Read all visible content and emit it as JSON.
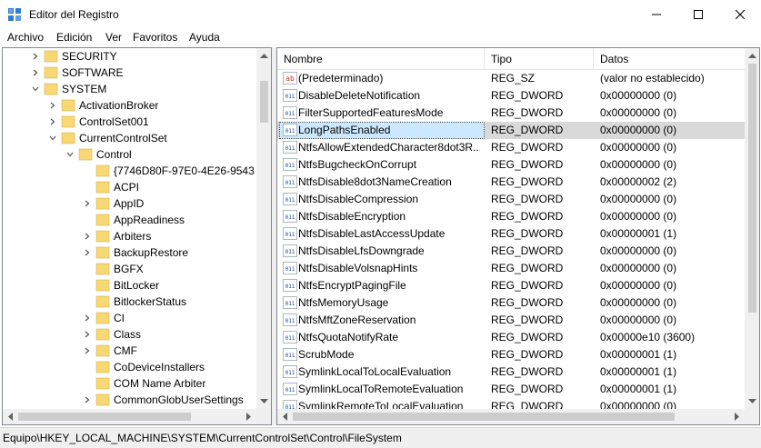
{
  "window": {
    "title": "Editor del Registro",
    "icon": "registry-editor-icon"
  },
  "menu": [
    {
      "label": "Archivo"
    },
    {
      "label": "Edición"
    },
    {
      "label": "Ver"
    },
    {
      "label": "Favoritos"
    },
    {
      "label": "Ayuda"
    }
  ],
  "tree": [
    {
      "label": "SECURITY",
      "expander": "right",
      "depth": 0
    },
    {
      "label": "SOFTWARE",
      "expander": "right",
      "depth": 0
    },
    {
      "label": "SYSTEM",
      "expander": "down",
      "depth": 0
    },
    {
      "label": "ActivationBroker",
      "expander": "right",
      "depth": 1
    },
    {
      "label": "ControlSet001",
      "expander": "right",
      "depth": 1
    },
    {
      "label": "CurrentControlSet",
      "expander": "down",
      "depth": 1
    },
    {
      "label": "Control",
      "expander": "down",
      "depth": 2
    },
    {
      "label": "{7746D80F-97E0-4E26-9543",
      "expander": "none",
      "depth": 3
    },
    {
      "label": "ACPI",
      "expander": "none",
      "depth": 3
    },
    {
      "label": "AppID",
      "expander": "right",
      "depth": 3
    },
    {
      "label": "AppReadiness",
      "expander": "none",
      "depth": 3
    },
    {
      "label": "Arbiters",
      "expander": "right",
      "depth": 3
    },
    {
      "label": "BackupRestore",
      "expander": "right",
      "depth": 3
    },
    {
      "label": "BGFX",
      "expander": "none",
      "depth": 3
    },
    {
      "label": "BitLocker",
      "expander": "none",
      "depth": 3
    },
    {
      "label": "BitlockerStatus",
      "expander": "none",
      "depth": 3
    },
    {
      "label": "CI",
      "expander": "right",
      "depth": 3
    },
    {
      "label": "Class",
      "expander": "right",
      "depth": 3
    },
    {
      "label": "CMF",
      "expander": "right",
      "depth": 3
    },
    {
      "label": "CoDeviceInstallers",
      "expander": "none",
      "depth": 3
    },
    {
      "label": "COM Name Arbiter",
      "expander": "none",
      "depth": 3
    },
    {
      "label": "CommonGlobUserSettings",
      "expander": "right",
      "depth": 3
    }
  ],
  "list": {
    "columns": [
      "Nombre",
      "Tipo",
      "Datos"
    ],
    "rows": [
      {
        "name": "(Predeterminado)",
        "type": "REG_SZ",
        "data": "(valor no establecido)",
        "icon": "string-value-icon"
      },
      {
        "name": "DisableDeleteNotification",
        "type": "REG_DWORD",
        "data": "0x00000000 (0)",
        "icon": "binary-value-icon"
      },
      {
        "name": "FilterSupportedFeaturesMode",
        "type": "REG_DWORD",
        "data": "0x00000000 (0)",
        "icon": "binary-value-icon"
      },
      {
        "name": "LongPathsEnabled",
        "type": "REG_DWORD",
        "data": "0x00000000 (0)",
        "icon": "binary-value-icon",
        "selected": true
      },
      {
        "name": "NtfsAllowExtendedCharacter8dot3R...",
        "type": "REG_DWORD",
        "data": "0x00000000 (0)",
        "icon": "binary-value-icon"
      },
      {
        "name": "NtfsBugcheckOnCorrupt",
        "type": "REG_DWORD",
        "data": "0x00000000 (0)",
        "icon": "binary-value-icon"
      },
      {
        "name": "NtfsDisable8dot3NameCreation",
        "type": "REG_DWORD",
        "data": "0x00000002 (2)",
        "icon": "binary-value-icon"
      },
      {
        "name": "NtfsDisableCompression",
        "type": "REG_DWORD",
        "data": "0x00000000 (0)",
        "icon": "binary-value-icon"
      },
      {
        "name": "NtfsDisableEncryption",
        "type": "REG_DWORD",
        "data": "0x00000000 (0)",
        "icon": "binary-value-icon"
      },
      {
        "name": "NtfsDisableLastAccessUpdate",
        "type": "REG_DWORD",
        "data": "0x00000001 (1)",
        "icon": "binary-value-icon"
      },
      {
        "name": "NtfsDisableLfsDowngrade",
        "type": "REG_DWORD",
        "data": "0x00000000 (0)",
        "icon": "binary-value-icon"
      },
      {
        "name": "NtfsDisableVolsnapHints",
        "type": "REG_DWORD",
        "data": "0x00000000 (0)",
        "icon": "binary-value-icon"
      },
      {
        "name": "NtfsEncryptPagingFile",
        "type": "REG_DWORD",
        "data": "0x00000000 (0)",
        "icon": "binary-value-icon"
      },
      {
        "name": "NtfsMemoryUsage",
        "type": "REG_DWORD",
        "data": "0x00000000 (0)",
        "icon": "binary-value-icon"
      },
      {
        "name": "NtfsMftZoneReservation",
        "type": "REG_DWORD",
        "data": "0x00000000 (0)",
        "icon": "binary-value-icon"
      },
      {
        "name": "NtfsQuotaNotifyRate",
        "type": "REG_DWORD",
        "data": "0x00000e10 (3600)",
        "icon": "binary-value-icon"
      },
      {
        "name": "ScrubMode",
        "type": "REG_DWORD",
        "data": "0x00000001 (1)",
        "icon": "binary-value-icon"
      },
      {
        "name": "SymlinkLocalToLocalEvaluation",
        "type": "REG_DWORD",
        "data": "0x00000001 (1)",
        "icon": "binary-value-icon"
      },
      {
        "name": "SymlinkLocalToRemoteEvaluation",
        "type": "REG_DWORD",
        "data": "0x00000001 (1)",
        "icon": "binary-value-icon"
      },
      {
        "name": "SymlinkRemoteToLocalEvaluation",
        "type": "REG_DWORD",
        "data": "0x00000000 (0)",
        "icon": "binary-value-icon"
      }
    ]
  },
  "status": {
    "path": "Equipo\\HKEY_LOCAL_MACHINE\\SYSTEM\\CurrentControlSet\\Control\\FileSystem"
  },
  "colors": {
    "folder": "#f8d775",
    "selection": "#cce8ff",
    "string_icon": "#c0392b",
    "binary_icon": "#1f4e9a"
  }
}
